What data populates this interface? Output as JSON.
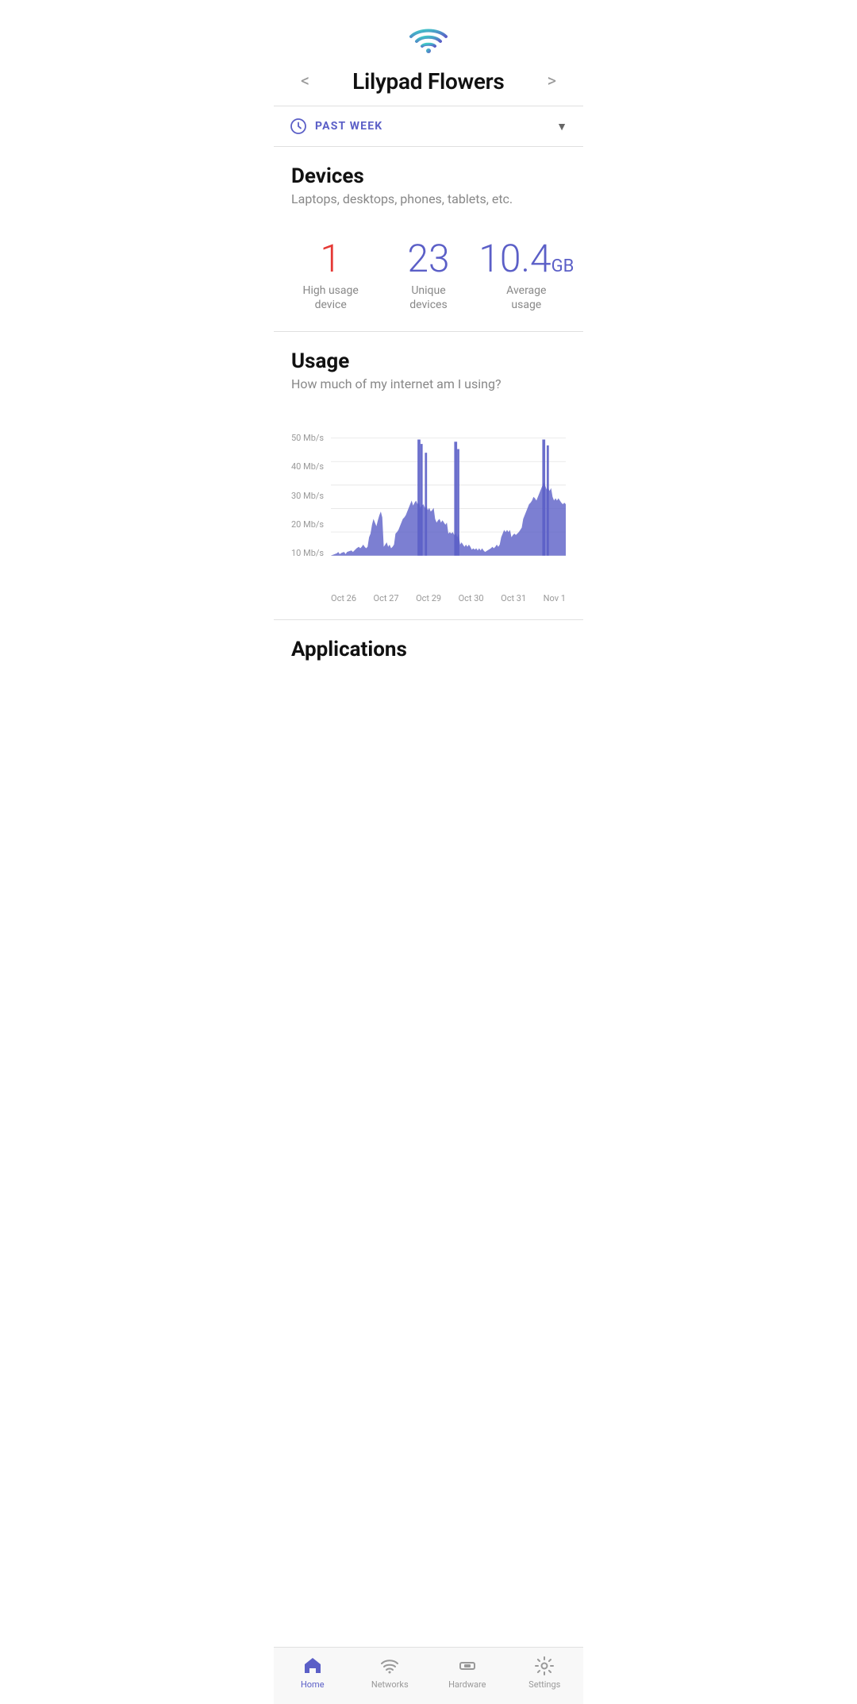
{
  "header": {
    "title": "Lilypad Flowers",
    "prev_arrow": "<",
    "next_arrow": ">"
  },
  "period": {
    "label": "PAST WEEK",
    "icon": "clock-icon"
  },
  "devices": {
    "section_title": "Devices",
    "section_subtitle": "Laptops, desktops, phones, tablets, etc.",
    "stats": [
      {
        "value": "1",
        "unit": "",
        "label": "High usage\ndevice",
        "color": "red"
      },
      {
        "value": "23",
        "unit": "",
        "label": "Unique\ndevices",
        "color": "purple"
      },
      {
        "value": "10.4",
        "unit": "GB",
        "label": "Average\nusage",
        "color": "blue-purple"
      }
    ]
  },
  "usage": {
    "section_title": "Usage",
    "section_subtitle": "How much of my internet am I using?",
    "y_labels": [
      "50 Mb/s",
      "40 Mb/s",
      "30 Mb/s",
      "20 Mb/s",
      "10 Mb/s"
    ],
    "x_labels": [
      "Oct 26",
      "Oct 27",
      "Oct 29",
      "Oct 30",
      "Oct 31",
      "Nov 1"
    ]
  },
  "applications": {
    "section_title": "Applications"
  },
  "bottom_nav": [
    {
      "id": "home",
      "label": "Home",
      "active": true
    },
    {
      "id": "networks",
      "label": "Networks",
      "active": false
    },
    {
      "id": "hardware",
      "label": "Hardware",
      "active": false
    },
    {
      "id": "settings",
      "label": "Settings",
      "active": false
    }
  ],
  "colors": {
    "accent": "#5b5fc7",
    "red": "#e53935",
    "wifi_top": "#3dccc7",
    "wifi_bottom": "#5b5fc7"
  }
}
